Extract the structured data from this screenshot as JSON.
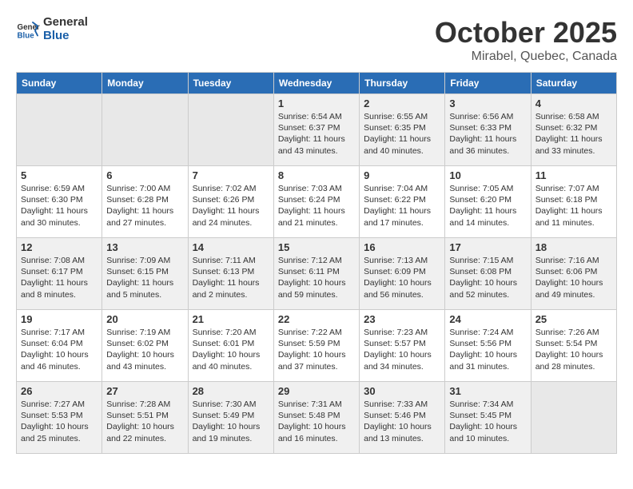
{
  "header": {
    "logo_line1": "General",
    "logo_line2": "Blue",
    "month": "October 2025",
    "location": "Mirabel, Quebec, Canada"
  },
  "weekdays": [
    "Sunday",
    "Monday",
    "Tuesday",
    "Wednesday",
    "Thursday",
    "Friday",
    "Saturday"
  ],
  "weeks": [
    [
      {
        "day": "",
        "empty": true
      },
      {
        "day": "",
        "empty": true
      },
      {
        "day": "",
        "empty": true
      },
      {
        "day": "1",
        "sunrise": "6:54 AM",
        "sunset": "6:37 PM",
        "daylight": "11 hours and 43 minutes."
      },
      {
        "day": "2",
        "sunrise": "6:55 AM",
        "sunset": "6:35 PM",
        "daylight": "11 hours and 40 minutes."
      },
      {
        "day": "3",
        "sunrise": "6:56 AM",
        "sunset": "6:33 PM",
        "daylight": "11 hours and 36 minutes."
      },
      {
        "day": "4",
        "sunrise": "6:58 AM",
        "sunset": "6:32 PM",
        "daylight": "11 hours and 33 minutes."
      }
    ],
    [
      {
        "day": "5",
        "sunrise": "6:59 AM",
        "sunset": "6:30 PM",
        "daylight": "11 hours and 30 minutes."
      },
      {
        "day": "6",
        "sunrise": "7:00 AM",
        "sunset": "6:28 PM",
        "daylight": "11 hours and 27 minutes."
      },
      {
        "day": "7",
        "sunrise": "7:02 AM",
        "sunset": "6:26 PM",
        "daylight": "11 hours and 24 minutes."
      },
      {
        "day": "8",
        "sunrise": "7:03 AM",
        "sunset": "6:24 PM",
        "daylight": "11 hours and 21 minutes."
      },
      {
        "day": "9",
        "sunrise": "7:04 AM",
        "sunset": "6:22 PM",
        "daylight": "11 hours and 17 minutes."
      },
      {
        "day": "10",
        "sunrise": "7:05 AM",
        "sunset": "6:20 PM",
        "daylight": "11 hours and 14 minutes."
      },
      {
        "day": "11",
        "sunrise": "7:07 AM",
        "sunset": "6:18 PM",
        "daylight": "11 hours and 11 minutes."
      }
    ],
    [
      {
        "day": "12",
        "sunrise": "7:08 AM",
        "sunset": "6:17 PM",
        "daylight": "11 hours and 8 minutes."
      },
      {
        "day": "13",
        "sunrise": "7:09 AM",
        "sunset": "6:15 PM",
        "daylight": "11 hours and 5 minutes."
      },
      {
        "day": "14",
        "sunrise": "7:11 AM",
        "sunset": "6:13 PM",
        "daylight": "11 hours and 2 minutes."
      },
      {
        "day": "15",
        "sunrise": "7:12 AM",
        "sunset": "6:11 PM",
        "daylight": "10 hours and 59 minutes."
      },
      {
        "day": "16",
        "sunrise": "7:13 AM",
        "sunset": "6:09 PM",
        "daylight": "10 hours and 56 minutes."
      },
      {
        "day": "17",
        "sunrise": "7:15 AM",
        "sunset": "6:08 PM",
        "daylight": "10 hours and 52 minutes."
      },
      {
        "day": "18",
        "sunrise": "7:16 AM",
        "sunset": "6:06 PM",
        "daylight": "10 hours and 49 minutes."
      }
    ],
    [
      {
        "day": "19",
        "sunrise": "7:17 AM",
        "sunset": "6:04 PM",
        "daylight": "10 hours and 46 minutes."
      },
      {
        "day": "20",
        "sunrise": "7:19 AM",
        "sunset": "6:02 PM",
        "daylight": "10 hours and 43 minutes."
      },
      {
        "day": "21",
        "sunrise": "7:20 AM",
        "sunset": "6:01 PM",
        "daylight": "10 hours and 40 minutes."
      },
      {
        "day": "22",
        "sunrise": "7:22 AM",
        "sunset": "5:59 PM",
        "daylight": "10 hours and 37 minutes."
      },
      {
        "day": "23",
        "sunrise": "7:23 AM",
        "sunset": "5:57 PM",
        "daylight": "10 hours and 34 minutes."
      },
      {
        "day": "24",
        "sunrise": "7:24 AM",
        "sunset": "5:56 PM",
        "daylight": "10 hours and 31 minutes."
      },
      {
        "day": "25",
        "sunrise": "7:26 AM",
        "sunset": "5:54 PM",
        "daylight": "10 hours and 28 minutes."
      }
    ],
    [
      {
        "day": "26",
        "sunrise": "7:27 AM",
        "sunset": "5:53 PM",
        "daylight": "10 hours and 25 minutes."
      },
      {
        "day": "27",
        "sunrise": "7:28 AM",
        "sunset": "5:51 PM",
        "daylight": "10 hours and 22 minutes."
      },
      {
        "day": "28",
        "sunrise": "7:30 AM",
        "sunset": "5:49 PM",
        "daylight": "10 hours and 19 minutes."
      },
      {
        "day": "29",
        "sunrise": "7:31 AM",
        "sunset": "5:48 PM",
        "daylight": "10 hours and 16 minutes."
      },
      {
        "day": "30",
        "sunrise": "7:33 AM",
        "sunset": "5:46 PM",
        "daylight": "10 hours and 13 minutes."
      },
      {
        "day": "31",
        "sunrise": "7:34 AM",
        "sunset": "5:45 PM",
        "daylight": "10 hours and 10 minutes."
      },
      {
        "day": "",
        "empty": true
      }
    ]
  ]
}
